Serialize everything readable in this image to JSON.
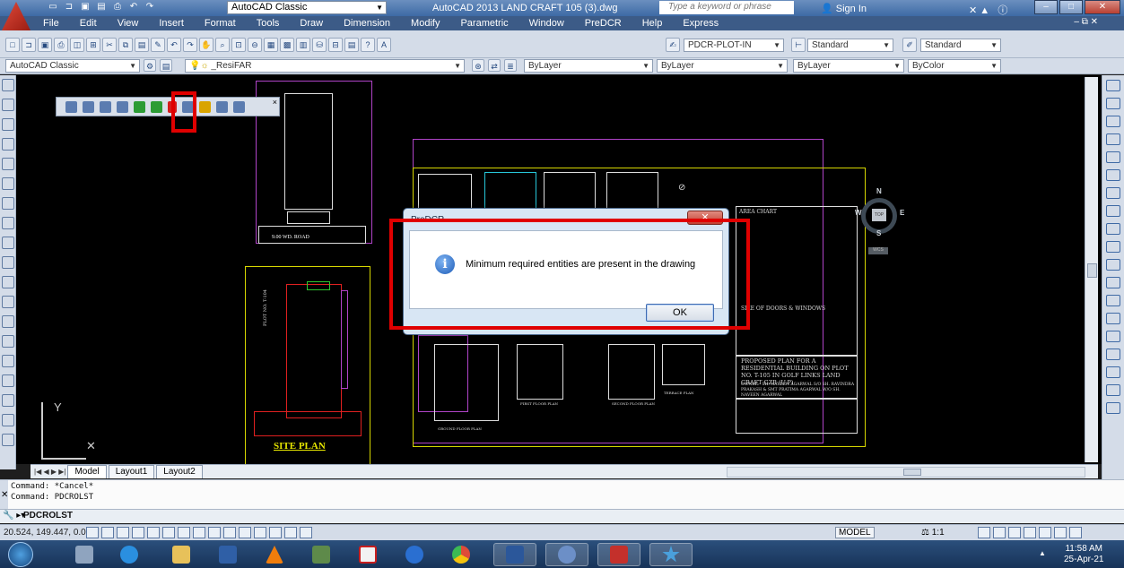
{
  "window": {
    "title": "AutoCAD 2013    LAND CRAFT 105 (3).dwg",
    "workspace": "AutoCAD Classic",
    "search_placeholder": "Type a keyword or phrase",
    "sign_in": "Sign In"
  },
  "menu": [
    "File",
    "Edit",
    "View",
    "Insert",
    "Format",
    "Tools",
    "Draw",
    "Dimension",
    "Modify",
    "Parametric",
    "Window",
    "PreDCR",
    "Help",
    "Express"
  ],
  "toolbar1": {
    "text_style": "PDCR-PLOT-IN",
    "dim_style": "Standard",
    "table_style": "Standard"
  },
  "toolbar2": {
    "workspace": "AutoCAD Classic",
    "layer": "_ResiFAR",
    "color": "ByLayer",
    "linetype": "ByLayer",
    "lineweight": "ByLayer",
    "plotstyle": "ByColor"
  },
  "drawing": {
    "road_label": "9.00 WD.  ROAD",
    "plot_label": "PLOT NO. T-104",
    "site_plan": "SITE  PLAN",
    "area_chart": "AREA CHART",
    "doors_windows": "SIZE OF DOORS & WINDOWS",
    "proposal": "PROPOSED PLAN FOR A RESIDENTIAL BUILDING ON PLOT NO. T-105 IN GOLF LINKS  LAND CRAFT GZB (U.P)",
    "owner": "OWNER:- SH. NAVEEN AGARWAL S/O SH. RAVINDRA PRAKASH & SMT PRATIMA AGARWAL W/O SH. NAVEEN AGARWAL",
    "ground_floor": "GROUND FLOOR PLAN",
    "first_floor": "FIRST FLOOR PLAN",
    "second_floor": "SECOND FLOOR PLAN",
    "terrace": "TERRACE PLAN",
    "compass": {
      "n": "N",
      "s": "S",
      "e": "E",
      "w": "W",
      "top": "TOP",
      "wcs": "WCS"
    }
  },
  "layout_tabs": [
    "Model",
    "Layout1",
    "Layout2"
  ],
  "dialog": {
    "title": "PreDCR",
    "message": "Minimum required entities are present in the drawing",
    "ok": "OK"
  },
  "command_history": [
    "Command: *Cancel*",
    "Command: PDCROLST"
  ],
  "command_prompt": "PDCROLST",
  "status": {
    "coords": "20.524, 149.447, 0.000",
    "model": "MODEL",
    "scale": "1:1"
  },
  "taskbar": {
    "time": "11:58 AM",
    "date": "25-Apr-21"
  },
  "colors": {
    "highlight": "#e00000",
    "title_bar": "#3d6aa5",
    "canvas": "#000000"
  }
}
